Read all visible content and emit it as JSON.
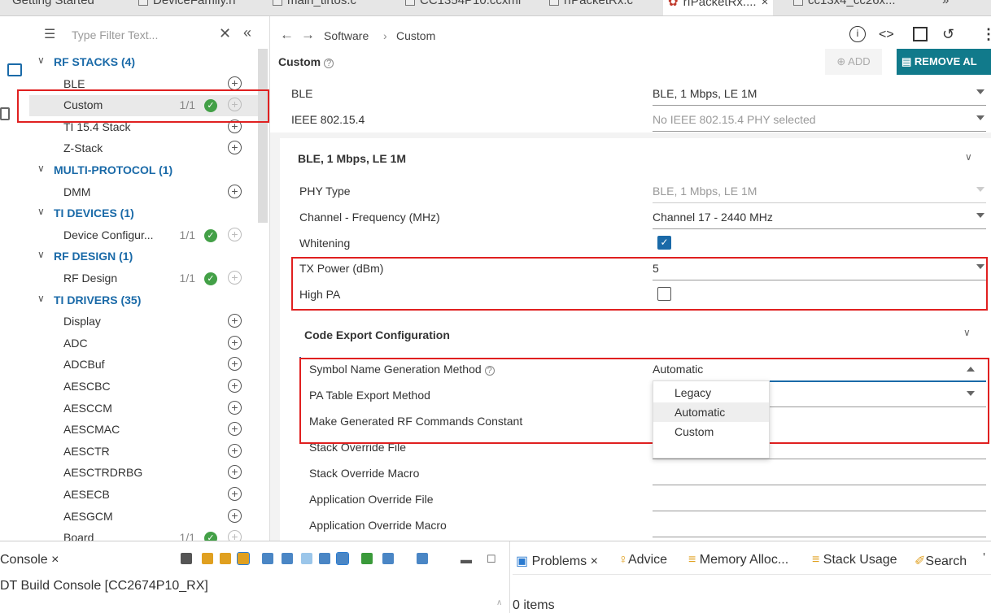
{
  "editor_tabs": [
    {
      "label": "Getting Started"
    },
    {
      "label": "DeviceFamily.h"
    },
    {
      "label": "main_tirtos.c"
    },
    {
      "label": "CC1354P10.ccxml"
    },
    {
      "label": "rfPacketRx.c"
    },
    {
      "label": "rfPacketRx....",
      "close": "×",
      "active": true
    },
    {
      "label": "cc13x4_cc26x..."
    },
    {
      "label": "»"
    }
  ],
  "sidebar": {
    "filter_placeholder": "Type Filter Text...",
    "categories": [
      {
        "label": "RF STACKS (4)",
        "items": [
          {
            "label": "BLE"
          },
          {
            "label": "Custom",
            "count": "1/1",
            "ok": true,
            "selected": true
          },
          {
            "label": "TI 15.4 Stack"
          },
          {
            "label": "Z-Stack"
          }
        ]
      },
      {
        "label": "MULTI-PROTOCOL (1)",
        "items": [
          {
            "label": "DMM"
          }
        ]
      },
      {
        "label": "TI DEVICES (1)",
        "items": [
          {
            "label": "Device Configur...",
            "count": "1/1",
            "ok": true
          }
        ]
      },
      {
        "label": "RF DESIGN (1)",
        "items": [
          {
            "label": "RF Design",
            "count": "1/1",
            "ok": true
          }
        ]
      },
      {
        "label": "TI DRIVERS (35)",
        "items": [
          {
            "label": "Display"
          },
          {
            "label": "ADC"
          },
          {
            "label": "ADCBuf"
          },
          {
            "label": "AESCBC"
          },
          {
            "label": "AESCCM"
          },
          {
            "label": "AESCMAC"
          },
          {
            "label": "AESCTR"
          },
          {
            "label": "AESCTRDRBG"
          },
          {
            "label": "AESECB"
          },
          {
            "label": "AESGCM"
          },
          {
            "label": "Board",
            "count": "1/1",
            "ok": true
          }
        ]
      }
    ]
  },
  "breadcrumb": {
    "root": "Software",
    "sep": "›",
    "current": "Custom"
  },
  "main": {
    "title": "Custom",
    "add_label": "ADD",
    "remove_label": "REMOVE AL",
    "top_fields": [
      {
        "label": "BLE",
        "value": "BLE, 1 Mbps, LE 1M"
      },
      {
        "label": "IEEE 802.15.4",
        "value": "No IEEE 802.15.4 PHY selected"
      }
    ],
    "phy_section": {
      "title": "BLE, 1 Mbps, LE 1M",
      "phy_type_label": "PHY Type",
      "phy_type_value": "BLE, 1 Mbps, LE 1M",
      "channel_label": "Channel - Frequency (MHz)",
      "channel_value": "Channel 17 - 2440 MHz",
      "whitening_label": "Whitening",
      "whitening_checked": true,
      "tx_label": "TX Power (dBm)",
      "tx_value": "5",
      "highpa_label": "High PA",
      "highpa_checked": false
    },
    "code_export": {
      "title": "Code Export Configuration",
      "symbol_label": "Symbol Name Generation Method",
      "symbol_value": "Automatic",
      "patable_label": "PA Table Export Method",
      "makeconst_label": "Make Generated RF Commands Constant",
      "stack_override_file_label": "Stack Override File",
      "stack_override_macro_label": "Stack Override Macro",
      "app_override_file_label": "Application Override File",
      "app_override_macro_label": "Application Override Macro",
      "dropdown_options": [
        "Legacy",
        "Automatic",
        "Custom"
      ],
      "dropdown_highlight": "Automatic"
    }
  },
  "bottom": {
    "console_tab": "Console",
    "console_title": "DT Build Console [CC2674P10_RX]",
    "problems_tab": "Problems",
    "advice_tab": "Advice",
    "memory_tab": "Memory Alloc...",
    "stack_tab": "Stack Usage",
    "search_tab": "Search",
    "items_count": "0 items"
  },
  "colors": {
    "accent": "#1a6aa8",
    "highlight_red": "#e02020",
    "ok_green": "#43a047",
    "remove_btn": "#117a8b"
  }
}
